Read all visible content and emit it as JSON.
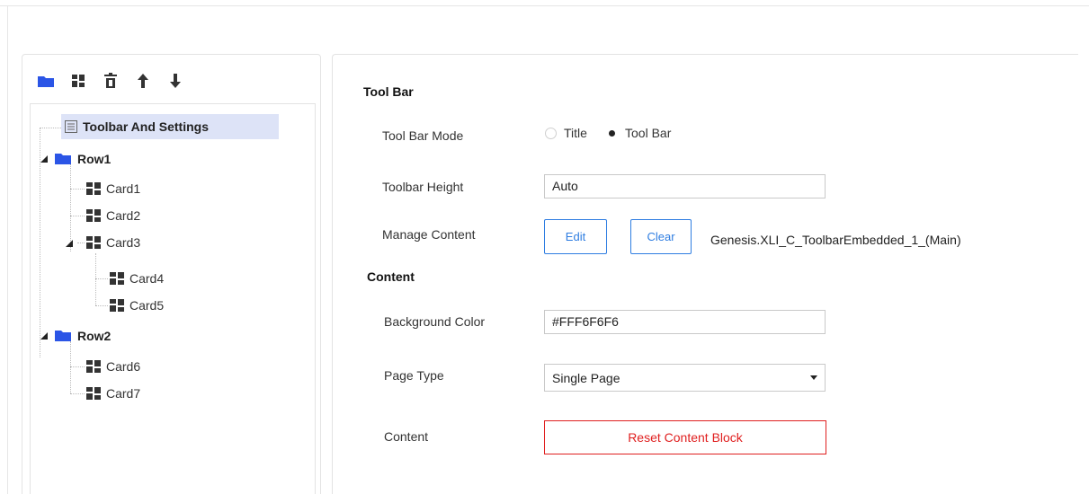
{
  "tree": {
    "nodes": [
      {
        "label": "Toolbar And Settings"
      },
      {
        "label": "Row1"
      },
      {
        "label": "Card1"
      },
      {
        "label": "Card2"
      },
      {
        "label": "Card3"
      },
      {
        "label": "Card4"
      },
      {
        "label": "Card5"
      },
      {
        "label": "Row2"
      },
      {
        "label": "Card6"
      },
      {
        "label": "Card7"
      }
    ]
  },
  "settings": {
    "toolbar_section": "Tool Bar",
    "toolbar_mode_label": "Tool Bar Mode",
    "mode_option_title": "Title",
    "mode_option_toolbar": "Tool Bar",
    "mode_selected": "Tool Bar",
    "toolbar_height_label": "Toolbar Height",
    "toolbar_height_value": "Auto",
    "manage_content_label": "Manage Content",
    "edit_label": "Edit",
    "clear_label": "Clear",
    "content_name": "Genesis.XLI_C_ToolbarEmbedded_1_(Main)",
    "content_section": "Content",
    "bg_color_label": "Background Color",
    "bg_color_value": "#FFF6F6F6",
    "page_type_label": "Page Type",
    "page_type_value": "Single Page",
    "content_label": "Content",
    "reset_label": "Reset Content Block"
  },
  "colors": {
    "folder": "#2b55e6",
    "accent": "#2e7de1",
    "danger": "#e02020",
    "selected_bg": "#dde3f7"
  },
  "icons": [
    "folder-icon",
    "card-icon",
    "delete-icon",
    "arrow-up-icon",
    "arrow-down-icon",
    "settings-list-icon"
  ]
}
